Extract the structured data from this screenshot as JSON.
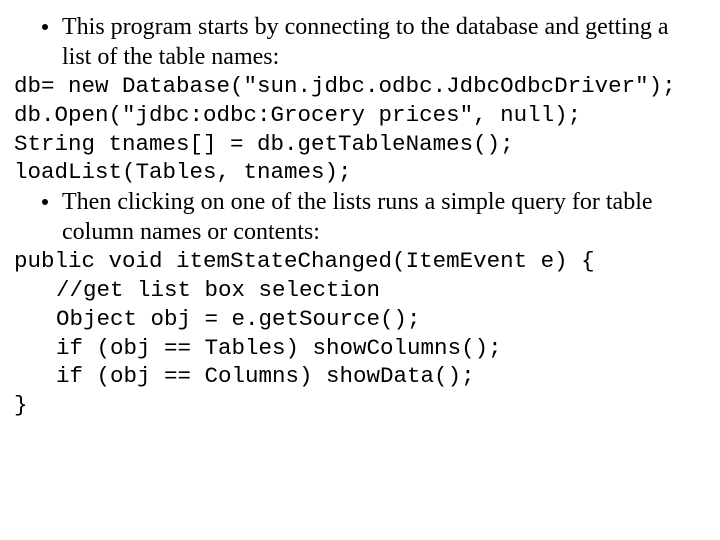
{
  "slide": {
    "bullet1": "This program starts by connecting to the database and getting a list of the table names:",
    "code1_l1": "db= new Database(\"sun.jdbc.odbc.JdbcOdbcDriver\");",
    "code1_l2": "db.Open(\"jdbc:odbc:Grocery prices\", null);",
    "code1_l3": "String tnames[] = db.getTableNames();",
    "code1_l4": "loadList(Tables, tnames);",
    "bullet2": "Then clicking on one of the lists runs a simple query for table column names or contents:",
    "code2_l1": "public void itemStateChanged(ItemEvent e) {",
    "code2_l2": "//get list box selection",
    "code2_l3": "Object obj = e.getSource();",
    "code2_l4": "if (obj == Tables) showColumns();",
    "code2_l5": "if (obj == Columns) showData();",
    "code2_l6": "}"
  }
}
